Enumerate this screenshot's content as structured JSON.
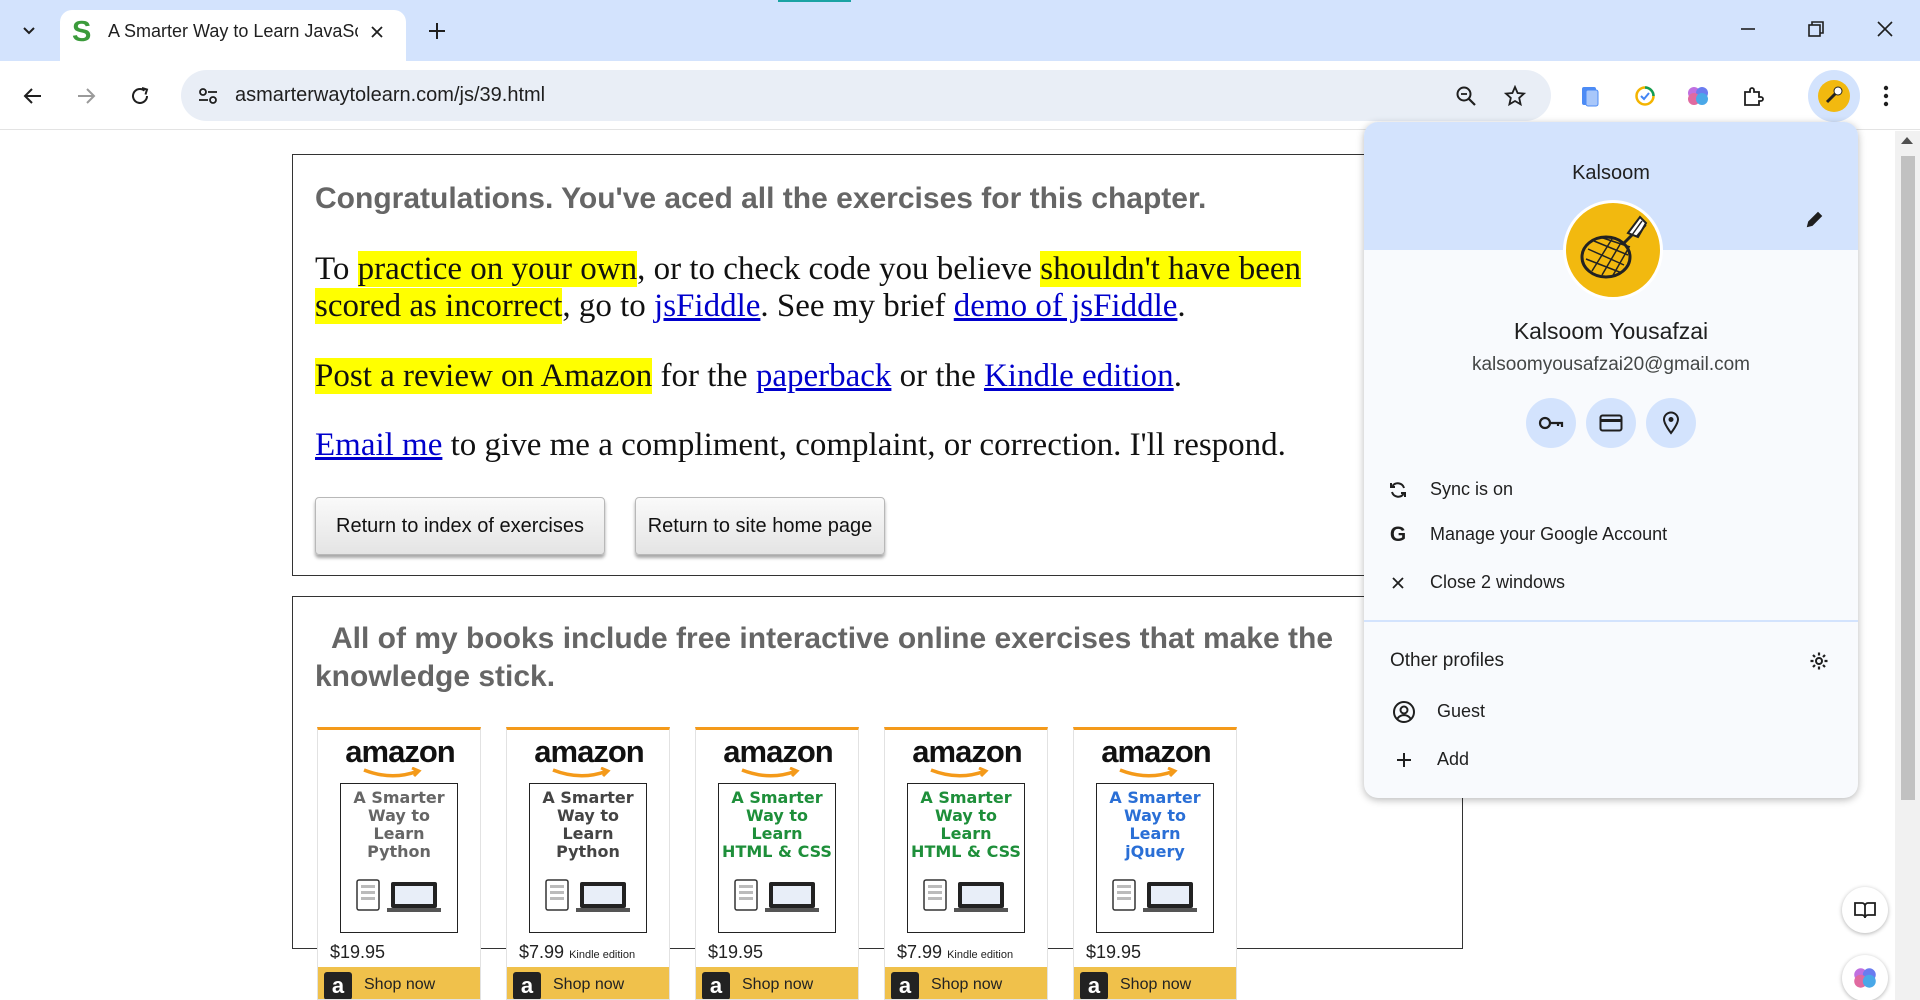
{
  "browser": {
    "tab": {
      "favicon": "S",
      "title": "A Smarter Way to Learn JavaScript"
    },
    "address_bar": {
      "url": "asmarterwaytolearn.com/js/39.html"
    }
  },
  "page": {
    "completion_heading": "Congratulations. You've aced all the exercises for this chapter.",
    "practice": {
      "to": "To ",
      "practice_hl": "practice on your own",
      "mid1": ", or to check code you believe ",
      "shouldnt_hl": "shouldn't have been",
      "scored_hl": "scored as incorrect",
      "mid2": ", go to ",
      "jsfiddle_link": "jsFiddle",
      "mid3": ". See my brief ",
      "demo_link": "demo of jsFiddle",
      "end": "."
    },
    "review": {
      "review_hl": "Post a review on Amazon",
      "mid1": " for the ",
      "paperback_link": "paperback",
      "mid2": " or the ",
      "kindle_link": "Kindle edition",
      "end": "."
    },
    "email": {
      "email_link": "Email me",
      "rest": " to give me a compliment, complaint, or correction. I'll respond."
    },
    "buttons": {
      "return_index": "Return to index of exercises",
      "return_home": "Return to site home page"
    },
    "books_heading_line1": "All of my books include free interactive online exercises that make the",
    "books_heading_line2": "knowledge stick.",
    "books": [
      {
        "logo": "amazon",
        "cover_l1": "A Smarter",
        "cover_l2": "Way to",
        "cover_l3": "Learn",
        "cover_l4": "Python",
        "cover_color": "#666666",
        "price": "$19.95",
        "edition": "",
        "shop": "Shop now"
      },
      {
        "logo": "amazon",
        "cover_l1": "A Smarter",
        "cover_l2": "Way to",
        "cover_l3": "Learn",
        "cover_l4": "Python",
        "cover_color": "#444444",
        "price": "$7.99",
        "edition": "Kindle edition",
        "shop": "Shop now"
      },
      {
        "logo": "amazon",
        "cover_l1": "A Smarter",
        "cover_l2": "Way to",
        "cover_l3": "Learn",
        "cover_l4": "HTML & CSS",
        "cover_color": "#1e8f3a",
        "price": "$19.95",
        "edition": "",
        "shop": "Shop now"
      },
      {
        "logo": "amazon",
        "cover_l1": "A Smarter",
        "cover_l2": "Way to",
        "cover_l3": "Learn",
        "cover_l4": "HTML & CSS",
        "cover_color": "#1e8f3a",
        "price": "$7.99",
        "edition": "Kindle edition",
        "shop": "Shop now"
      },
      {
        "logo": "amazon",
        "cover_l1": "A Smarter",
        "cover_l2": "Way to",
        "cover_l3": "Learn",
        "cover_l4": "jQuery",
        "cover_color": "#2a6fd6",
        "price": "$19.95",
        "edition": "",
        "shop": "Shop now"
      }
    ]
  },
  "profile_menu": {
    "profile_name": "Kalsoom",
    "full_name": "Kalsoom Yousafzai",
    "email": "kalsoomyousafzai20@gmail.com",
    "items": {
      "sync": "Sync is on",
      "manage": "Manage your Google Account",
      "close_windows": "Close 2 windows"
    },
    "other_profiles_label": "Other profiles",
    "guest": "Guest",
    "add": "Add"
  },
  "colors": {
    "highlight": "#ffff00",
    "link": "#0000cc",
    "chrome_accent": "#d3e3fd",
    "avatar": "#f2b90f"
  }
}
